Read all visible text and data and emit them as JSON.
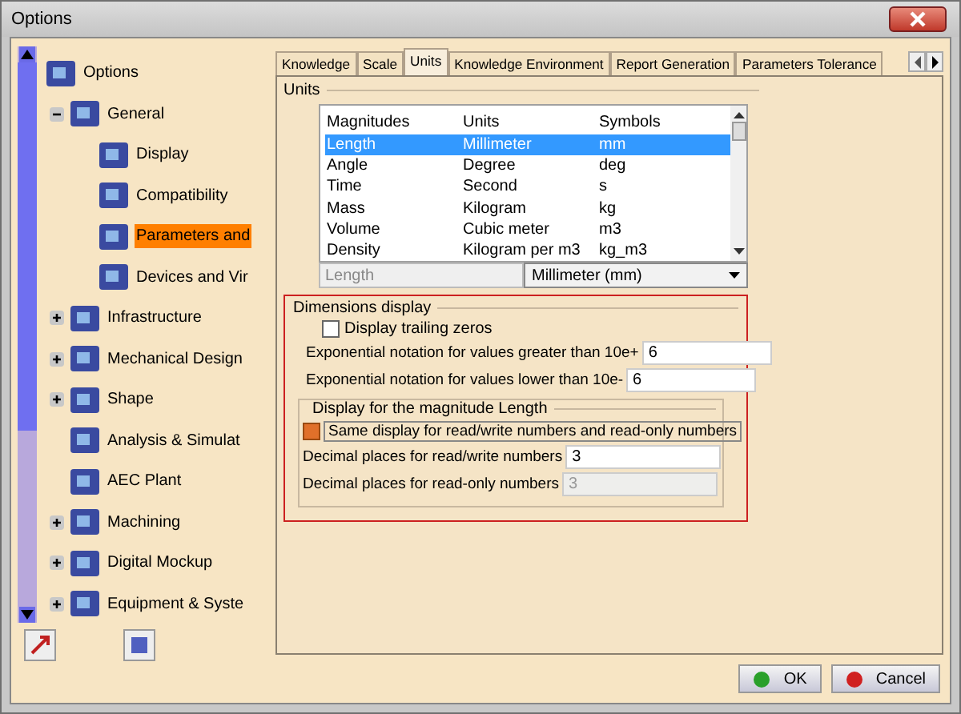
{
  "window": {
    "title": "Options"
  },
  "tree": [
    {
      "label": "Options",
      "selected": false,
      "children": [
        {
          "label": "General",
          "expanded": true,
          "selected": false,
          "children": [
            {
              "label": "Display",
              "selected": false
            },
            {
              "label": "Compatibility",
              "selected": false
            },
            {
              "label": "Parameters and",
              "selected": true
            },
            {
              "label": "Devices and Vir",
              "selected": false
            }
          ]
        },
        {
          "label": "Infrastructure",
          "expanded": false,
          "selected": false
        },
        {
          "label": "Mechanical Design",
          "expanded": false,
          "selected": false
        },
        {
          "label": "Shape",
          "expanded": false,
          "selected": false
        },
        {
          "label": "Analysis & Simulat",
          "selected": false
        },
        {
          "label": "AEC Plant",
          "selected": false
        },
        {
          "label": "Machining",
          "expanded": false,
          "selected": false
        },
        {
          "label": "Digital Mockup",
          "expanded": false,
          "selected": false
        },
        {
          "label": "Equipment & Syste",
          "expanded": false,
          "selected": false
        }
      ]
    }
  ],
  "tabs": [
    {
      "label": "Knowledge",
      "selected": false
    },
    {
      "label": "Scale",
      "selected": false
    },
    {
      "label": "Units",
      "selected": true
    },
    {
      "label": "Knowledge Environment",
      "selected": false
    },
    {
      "label": "Report Generation",
      "selected": false
    },
    {
      "label": "Parameters Tolerance",
      "selected": false
    }
  ],
  "units": {
    "title": "Units",
    "columns": [
      "Magnitudes",
      "Units",
      "Symbols"
    ],
    "rows": [
      {
        "cells": [
          "Length",
          "Millimeter",
          "mm"
        ],
        "selected": true
      },
      {
        "cells": [
          "Angle",
          "Degree",
          "deg"
        ],
        "selected": false
      },
      {
        "cells": [
          "Time",
          "Second",
          "s"
        ],
        "selected": false
      },
      {
        "cells": [
          "Mass",
          "Kilogram",
          "kg"
        ],
        "selected": false
      },
      {
        "cells": [
          "Volume",
          "Cubic meter",
          "m3"
        ],
        "selected": false
      },
      {
        "cells": [
          "Density",
          "Kilogram per m3",
          "kg_m3"
        ],
        "selected": false
      }
    ],
    "magnitude": "Length",
    "unit": "Millimeter (mm)"
  },
  "dimensions": {
    "title": "Dimensions display",
    "trailing_zeros": {
      "label": "Display trailing zeros",
      "checked": false
    },
    "fields": [
      {
        "label": "Exponential notation for values greater than 10e+",
        "value": "6"
      },
      {
        "label": "Exponential notation for values lower than 10e-",
        "value": "6"
      }
    ],
    "magnitude_group": {
      "title": "Display for the magnitude Length",
      "same_display": {
        "label": "Same display for read/write numbers and read-only numbers",
        "checked": true
      },
      "fields": [
        {
          "label": "Decimal places for read/write numbers",
          "value": "3",
          "disabled": false
        },
        {
          "label": "Decimal places for read-only numbers",
          "value": "3",
          "disabled": true
        }
      ]
    }
  },
  "buttons": [
    {
      "label": "OK",
      "kind": "ok"
    },
    {
      "label": "Cancel",
      "kind": "cancel"
    }
  ]
}
